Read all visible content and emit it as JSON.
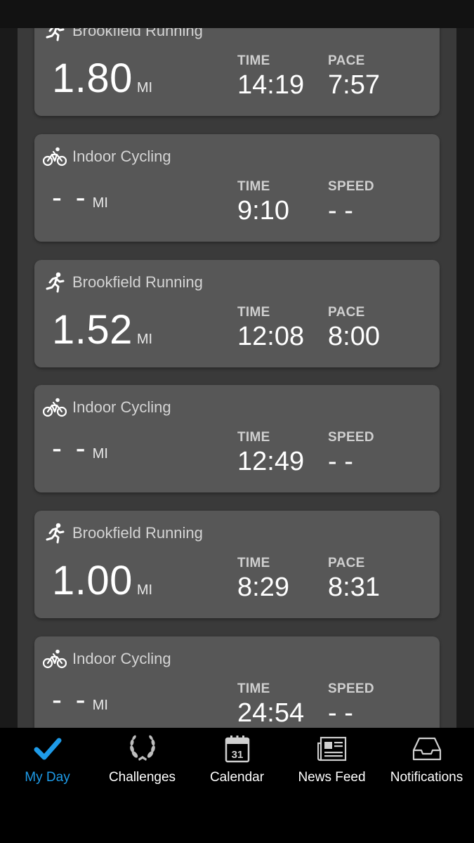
{
  "colors": {
    "accent": "#1e9be8",
    "card_bg": "#575757",
    "panel_bg": "#3a3a3a"
  },
  "activities": [
    {
      "type": "running",
      "icon": "running-icon",
      "title": "Brookfield Running",
      "distance": "1.80",
      "unit": "MI",
      "time_label": "TIME",
      "time": "14:19",
      "second_label": "PACE",
      "second_value": "7:57"
    },
    {
      "type": "cycling",
      "icon": "bicycle-icon",
      "title": "Indoor Cycling",
      "distance": "- -",
      "unit": "MI",
      "time_label": "TIME",
      "time": "9:10",
      "second_label": "SPEED",
      "second_value": "- -"
    },
    {
      "type": "running",
      "icon": "running-icon",
      "title": "Brookfield Running",
      "distance": "1.52",
      "unit": "MI",
      "time_label": "TIME",
      "time": "12:08",
      "second_label": "PACE",
      "second_value": "8:00"
    },
    {
      "type": "cycling",
      "icon": "bicycle-icon",
      "title": "Indoor Cycling",
      "distance": "- -",
      "unit": "MI",
      "time_label": "TIME",
      "time": "12:49",
      "second_label": "SPEED",
      "second_value": "- -"
    },
    {
      "type": "running",
      "icon": "running-icon",
      "title": "Brookfield Running",
      "distance": "1.00",
      "unit": "MI",
      "time_label": "TIME",
      "time": "8:29",
      "second_label": "PACE",
      "second_value": "8:31"
    },
    {
      "type": "cycling",
      "icon": "bicycle-icon",
      "title": "Indoor Cycling",
      "distance": "- -",
      "unit": "MI",
      "time_label": "TIME",
      "time": "24:54",
      "second_label": "SPEED",
      "second_value": "- -"
    }
  ],
  "tabbar": {
    "tabs": [
      {
        "label": "My Day",
        "icon": "checkmark-icon",
        "active": true
      },
      {
        "label": "Challenges",
        "icon": "laurel-icon",
        "active": false
      },
      {
        "label": "Calendar",
        "icon": "calendar-icon",
        "active": false,
        "calendar_day": "31"
      },
      {
        "label": "News Feed",
        "icon": "newspaper-icon",
        "active": false
      },
      {
        "label": "Notifications",
        "icon": "inbox-icon",
        "active": false
      }
    ]
  }
}
